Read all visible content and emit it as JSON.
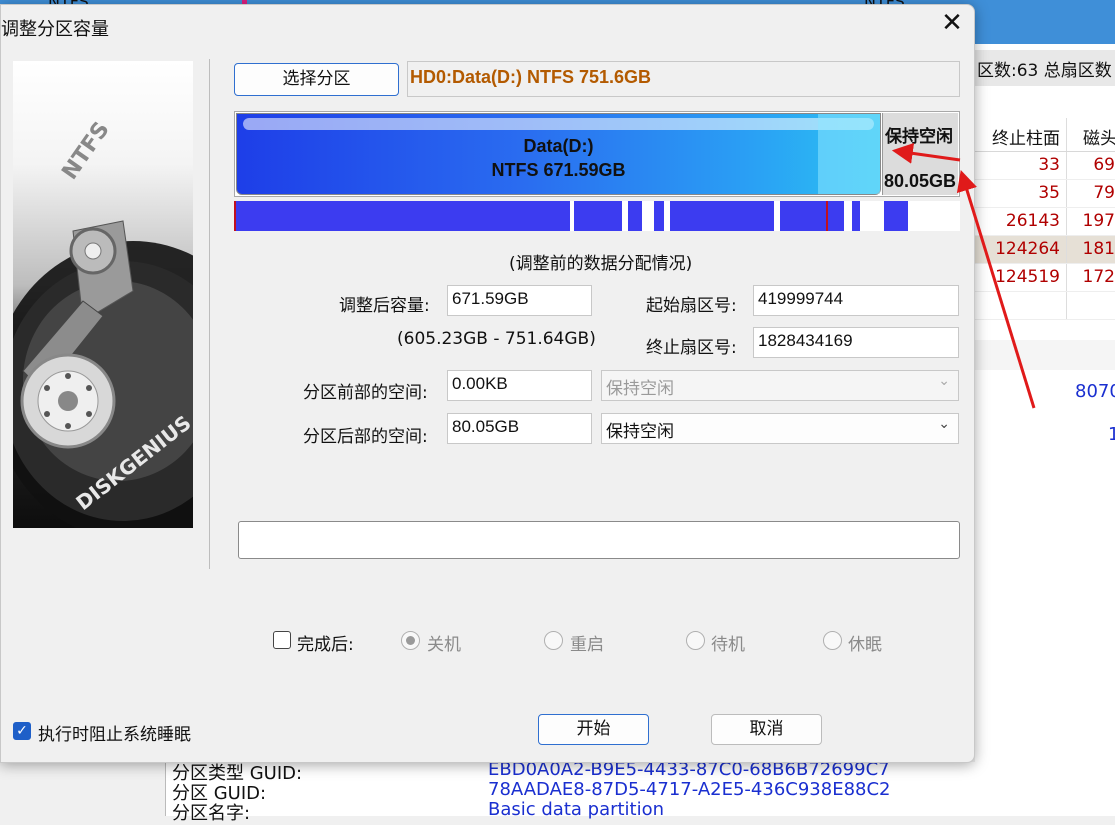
{
  "background": {
    "top_labels": [
      "NTFS",
      "NTFS"
    ],
    "stats_text": "区数:63  总扇区数",
    "table_headers": [
      "终止柱面",
      "磁头"
    ],
    "table_rows": [
      {
        "c1": "33",
        "c2": "69"
      },
      {
        "c1": "35",
        "c2": "79"
      },
      {
        "c1": "26143",
        "c2": "197"
      },
      {
        "c1": "124264",
        "c2": "181"
      },
      {
        "c1": "124519",
        "c2": "172"
      }
    ],
    "blue_values": [
      "8070",
      "1"
    ],
    "bottom_rows": [
      {
        "key": "分区类型 GUID:",
        "value": "EBD0A0A2-B9E5-4433-87C0-68B6B72699C7"
      },
      {
        "key": "分区 GUID:",
        "value": "78AADAE8-87D5-4717-A2E5-436C938E88C2"
      },
      {
        "key": "分区名字:",
        "value": "Basic data partition"
      }
    ]
  },
  "dialog": {
    "title": "调整分区容量",
    "close_glyph": "✕",
    "hdd_brand": "DISKGENIUS",
    "hdd_label_top": "NTFS",
    "select_partition_label": "选择分区",
    "partition_info": "HD0:Data(D:) NTFS 751.6GB",
    "bar": {
      "data_name": "Data(D:)",
      "data_size": "NTFS 671.59GB",
      "free_label": "保持空闲",
      "free_size": "80.05GB",
      "data_fraction": 0.8935
    },
    "usage_caption": "(调整前的数据分配情况)",
    "resized_capacity_label": "调整后容量:",
    "resized_capacity_value": "671.59GB",
    "capacity_range": "(605.23GB - 751.64GB)",
    "start_sector_label": "起始扇区号:",
    "start_sector_value": "419999744",
    "end_sector_label": "终止扇区号:",
    "end_sector_value": "1828434169",
    "space_before_label": "分区前部的空间:",
    "space_before_value": "0.00KB",
    "space_before_option": "保持空闲",
    "space_after_label": "分区后部的空间:",
    "space_after_value": "80.05GB",
    "space_after_option": "保持空闲",
    "after_complete_label": "完成后:",
    "after_options": [
      "关机",
      "重启",
      "待机",
      "休眠"
    ],
    "after_selected": "关机",
    "prevent_sleep_label": "执行时阻止系统睡眠",
    "start_button": "开始",
    "cancel_button": "取消"
  },
  "colors": {
    "accent": "#1e5fc8",
    "partition_info_text": "#b35a00",
    "arrow": "#e01a1a",
    "usage_blocks": "#3c3cf0"
  }
}
